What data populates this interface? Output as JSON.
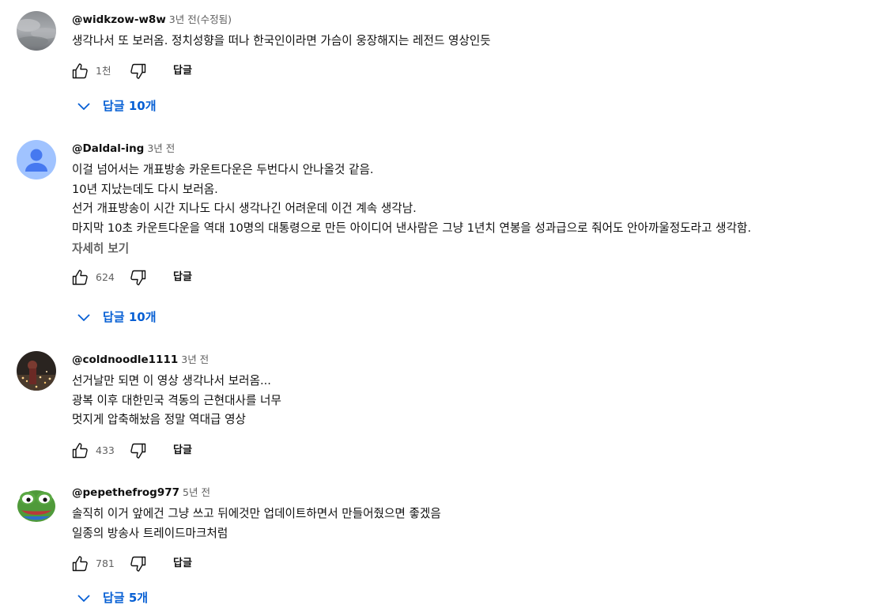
{
  "comments": [
    {
      "author": "@widkzow-w8w",
      "time": "3년 전(수정됨)",
      "lines": [
        "생각나서 또 보러옴. 정치성향을 떠나 한국인이라면 가슴이 웅장해지는 레전드 영상인듯"
      ],
      "likes": "1천",
      "reply_label": "답글",
      "replies_label": "답글 10개",
      "avatar_icon": "cloudy-sky-photo"
    },
    {
      "author": "@Daldal-ing",
      "time": "3년 전",
      "lines": [
        "이걸 넘어서는 개표방송 카운트다운은 두번다시 안나올것 같음.",
        "10년 지났는데도 다시 보러옴.",
        "선거 개표방송이 시간 지나도 다시 생각나긴 어려운데 이건 계속 생각남.",
        "마지막 10초 카운트다운을 역대 10명의 대통령으로 만든 아이디어 낸사람은 그냥 1년치 연봉을 성과급으로 줘어도 안아까울정도라고 생각함."
      ],
      "more_label": "자세히 보기",
      "likes": "624",
      "reply_label": "답글",
      "replies_label": "답글 10개",
      "avatar_icon": "default-person-avatar"
    },
    {
      "author": "@coldnoodle1111",
      "time": "3년 전",
      "lines": [
        "선거날만 되면 이 영상 생각나서 보러옴...",
        "광복 이후 대한민국 격동의 근현대사를 너무",
        "멋지게 압축해놨음 정말 역대급 영상"
      ],
      "likes": "433",
      "reply_label": "답글",
      "avatar_icon": "night-lights-photo"
    },
    {
      "author": "@pepethefrog977",
      "time": "5년 전",
      "lines": [
        "솔직히 이거 앞에건 그냥 쓰고 뒤에것만 업데이트하면서 만들어줬으면 좋겠음",
        "일종의 방송사 트레이드마크처럼"
      ],
      "likes": "781",
      "reply_label": "답글",
      "replies_label": "답글 5개",
      "avatar_icon": "frog-cartoon-avatar"
    }
  ],
  "colors": {
    "link_blue": "#065fd4",
    "muted_gray": "#606060",
    "text": "#0f0f0f",
    "default_avatar_bg": "#a0c3ff",
    "default_avatar_fg": "#4679f0"
  }
}
